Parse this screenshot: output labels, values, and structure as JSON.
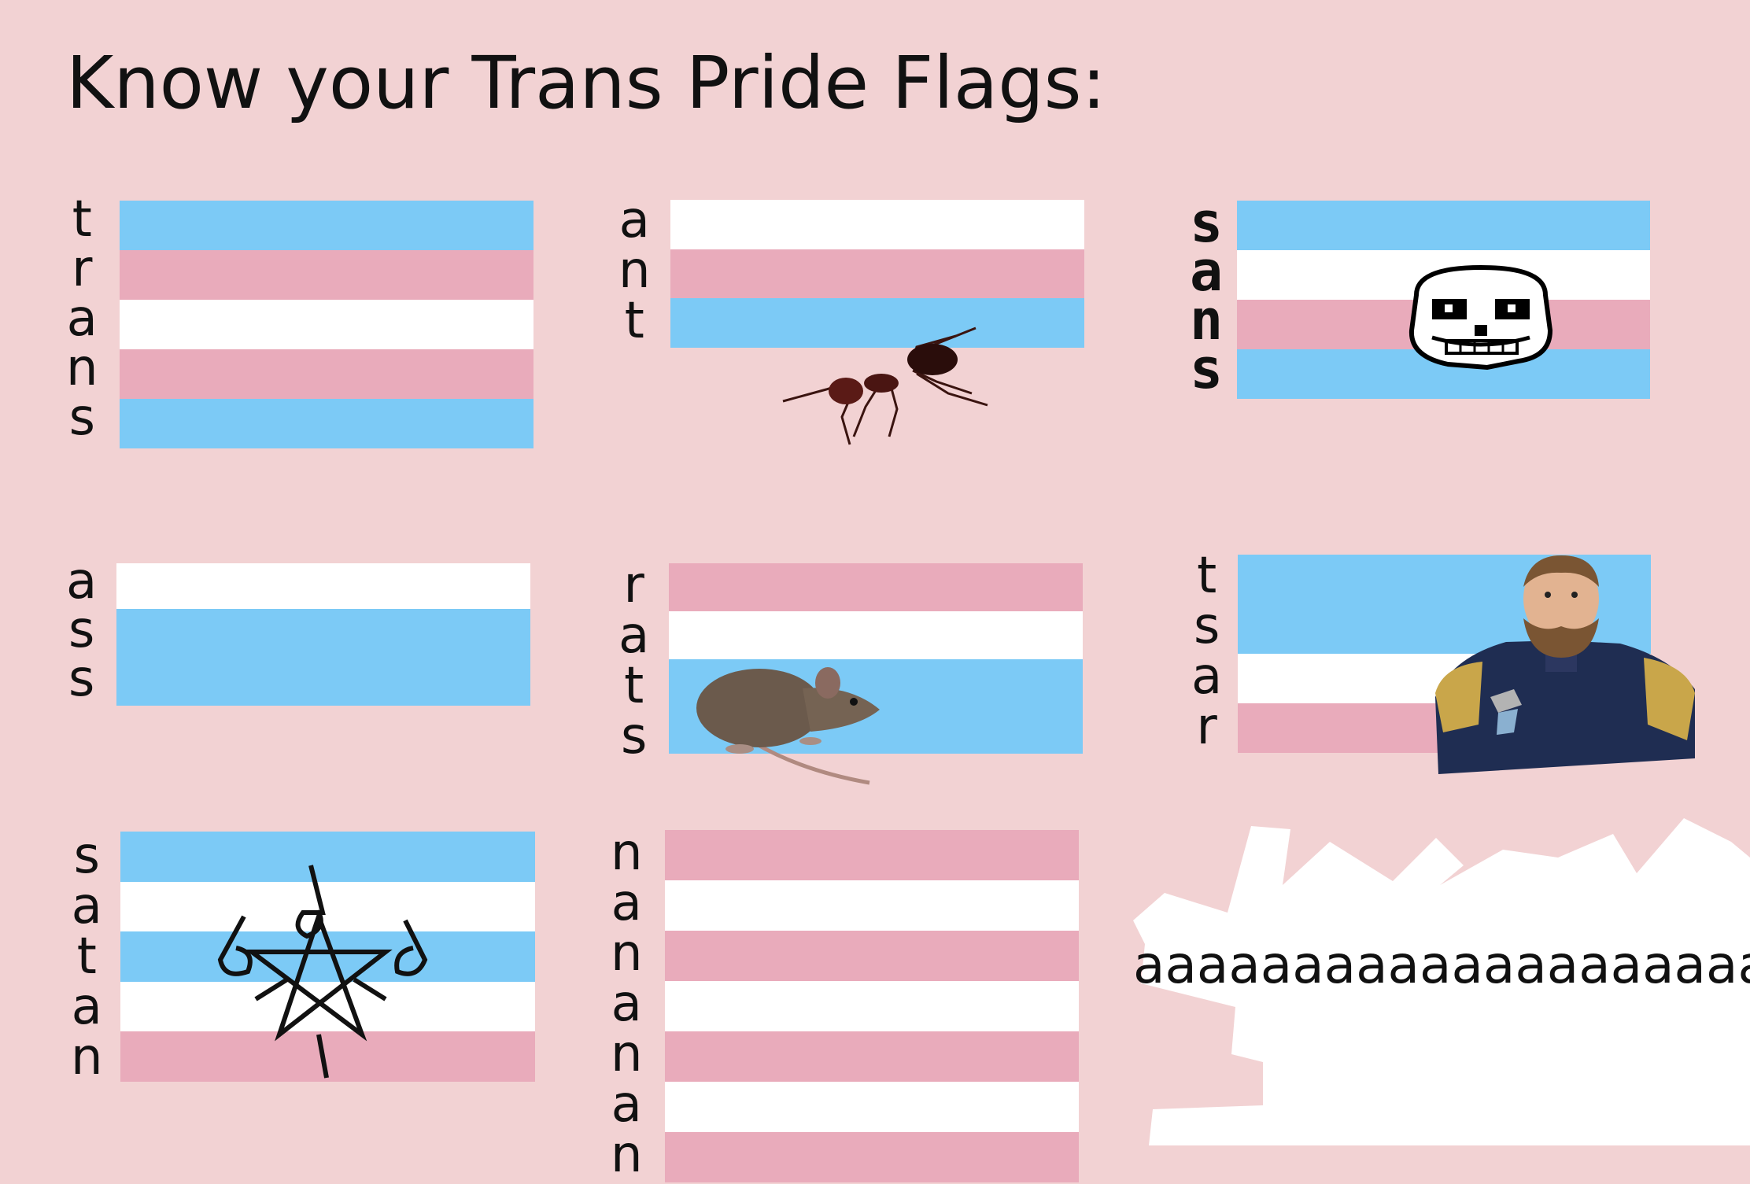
{
  "title": "Know your Trans Pride Flags:",
  "colors": {
    "background": "#f2d2d3",
    "blue": "#7ccaf6",
    "pink": "#e9abbb",
    "white": "#ffffff"
  },
  "flags": [
    {
      "word": "trans",
      "letters": [
        "t",
        "r",
        "a",
        "n",
        "s"
      ],
      "stripes": [
        "blue",
        "pink",
        "white",
        "pink",
        "blue"
      ]
    },
    {
      "word": "ant",
      "letters": [
        "a",
        "n",
        "t"
      ],
      "stripes": [
        "white",
        "pink",
        "blue"
      ],
      "image": "ant"
    },
    {
      "word": "sans",
      "letters": [
        "s",
        "a",
        "n",
        "s"
      ],
      "stripes": [
        "blue",
        "white",
        "pink",
        "blue"
      ],
      "image": "skull"
    },
    {
      "word": "ass",
      "letters": [
        "a",
        "s",
        "s"
      ],
      "stripes": [
        "white",
        "blue",
        "blue"
      ]
    },
    {
      "word": "rats",
      "letters": [
        "r",
        "a",
        "t",
        "s"
      ],
      "stripes": [
        "pink",
        "white",
        "blue",
        "blue"
      ],
      "image": "rat"
    },
    {
      "word": "tsar",
      "letters": [
        "t",
        "s",
        "a",
        "r"
      ],
      "stripes": [
        "blue",
        "blue",
        "white",
        "pink"
      ],
      "image": "tsar-portrait"
    },
    {
      "word": "satan",
      "letters": [
        "s",
        "a",
        "t",
        "a",
        "n"
      ],
      "stripes": [
        "blue",
        "white",
        "blue",
        "white",
        "pink"
      ],
      "image": "666-pentagram"
    },
    {
      "word": "nanana",
      "letters": [
        "n",
        "a",
        "n",
        "a",
        "n",
        "a",
        "n"
      ],
      "stripes": [
        "pink",
        "white",
        "pink",
        "white",
        "pink",
        "white",
        "pink"
      ]
    }
  ],
  "scream_text": "aaaaaaaaaaaaaaaaaaaa"
}
